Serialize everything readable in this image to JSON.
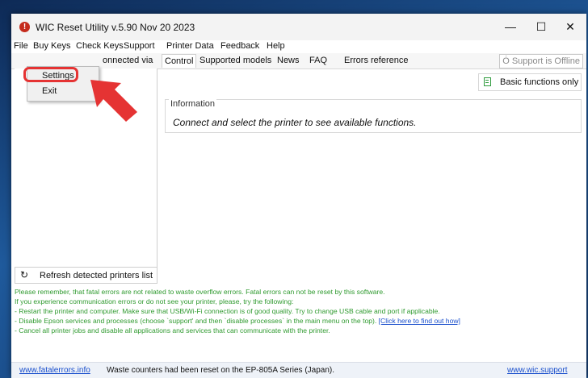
{
  "window": {
    "title": "WIC Reset Utility v.5.90 Nov 20 2023",
    "controls": {
      "minimize": "—",
      "maximize": "☐",
      "close": "✕"
    }
  },
  "menubar": {
    "items": [
      "File",
      "Buy Keys",
      "Check Keys",
      "Support",
      "Printer Data",
      "Feedback",
      "Help"
    ]
  },
  "file_menu": {
    "items": [
      "Settings",
      "Exit"
    ]
  },
  "left_panel": {
    "header_partial": "onnected via",
    "refresh_label": "Refresh detected printers list"
  },
  "tabs": {
    "items": [
      "Control",
      "Supported models",
      "News",
      "FAQ",
      "Errors reference"
    ],
    "active": "Control"
  },
  "support_status": "Support is Offline",
  "control": {
    "basic_functions_label": "Basic functions only",
    "info_legend": "Information",
    "info_message": "Connect and select the printer to see available functions."
  },
  "notes": {
    "line1": "Please remember, that fatal errors are not related to waste overflow errors. Fatal errors can not be reset by this software.",
    "line2": "If you experience communication errors or do not see your printer, please, try the following:",
    "line3": "- Restart the printer and computer. Make sure that USB/Wi-Fi connection is of good quality. Try to change USB cable and port if applicable.",
    "line4_prefix": "- Disable Epson services and processes (choose `support' and then `disable processes` in the main menu on the top).",
    "line4_link": "[Click here to find out how]",
    "line5": "- Cancel all printer jobs and disable all applications and services that can communicate with the printer."
  },
  "statusbar": {
    "left_link": "www.fatalerrors.info",
    "message": "Waste counters had been reset on the EP-805A Series (Japan).",
    "right_link": "www.wic.support"
  },
  "colors": {
    "notes_text": "#2f9a2f",
    "link": "#1a4fcc",
    "highlight": "#e53333",
    "app_icon": "#c42b1c"
  }
}
